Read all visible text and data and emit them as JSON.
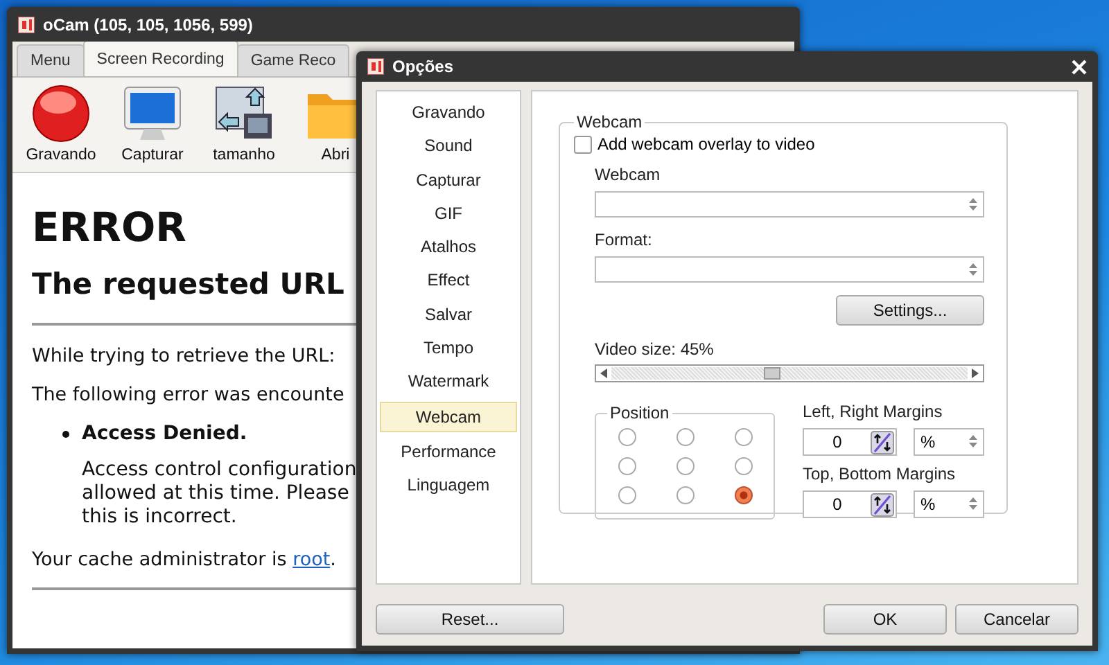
{
  "ocam_window": {
    "title": "oCam (105, 105, 1056, 599)",
    "tabs": [
      {
        "label": "Menu",
        "selected": false
      },
      {
        "label": "Screen Recording",
        "selected": true
      },
      {
        "label": "Game Reco",
        "selected": false
      }
    ],
    "toolbar": [
      {
        "label": "Gravando",
        "kind": "record"
      },
      {
        "label": "Capturar",
        "kind": "monitor"
      },
      {
        "label": "tamanho",
        "kind": "resize"
      },
      {
        "label": "Abri",
        "kind": "folder"
      }
    ],
    "page": {
      "heading": "ERROR",
      "subheading": "The requested URL",
      "paragraphs": [
        "While trying to retrieve the URL:",
        "The following error was encounte"
      ],
      "list_item": {
        "title": "Access Denied.",
        "lines": [
          "Access control configuration",
          "allowed at this time. Please",
          "this is incorrect."
        ]
      },
      "admin": {
        "text": "Your cache administrator is ",
        "link": "root",
        "suffix": "."
      }
    }
  },
  "options_dialog": {
    "title": "Opções",
    "sidebar": [
      {
        "label": "Gravando",
        "selected": false
      },
      {
        "label": "Sound",
        "selected": false
      },
      {
        "label": "Capturar",
        "selected": false
      },
      {
        "label": "GIF",
        "selected": false
      },
      {
        "label": "Atalhos",
        "selected": false
      },
      {
        "label": "Effect",
        "selected": false
      },
      {
        "label": "Salvar",
        "selected": false
      },
      {
        "label": "Tempo",
        "selected": false
      },
      {
        "label": "Watermark",
        "selected": false
      },
      {
        "label": "Webcam",
        "selected": true
      },
      {
        "label": "Performance",
        "selected": false
      },
      {
        "label": "Linguagem",
        "selected": false
      }
    ],
    "webcam_group": {
      "title": "Webcam",
      "overlay_checkbox": {
        "label": "Add webcam overlay to video",
        "checked": false
      },
      "webcam_label": "Webcam",
      "format_label": "Format:",
      "settings_button": "Settings...",
      "video_size": {
        "label": "Video size: 45%",
        "level": 0.45
      },
      "position": {
        "title": "Position",
        "options": [
          {
            "selected": false
          },
          {
            "selected": false
          },
          {
            "selected": false
          },
          {
            "selected": false
          },
          {
            "selected": false
          },
          {
            "selected": false
          },
          {
            "selected": false
          },
          {
            "selected": false
          },
          {
            "selected": true
          }
        ]
      },
      "margins": [
        {
          "label": "Left, Right Margins",
          "value": "0",
          "unit": "%"
        },
        {
          "label": "Top, Bottom Margins",
          "value": "0",
          "unit": "%"
        }
      ]
    },
    "buttons": {
      "reset": "Reset...",
      "ok": "OK",
      "cancel": "Cancelar"
    }
  }
}
